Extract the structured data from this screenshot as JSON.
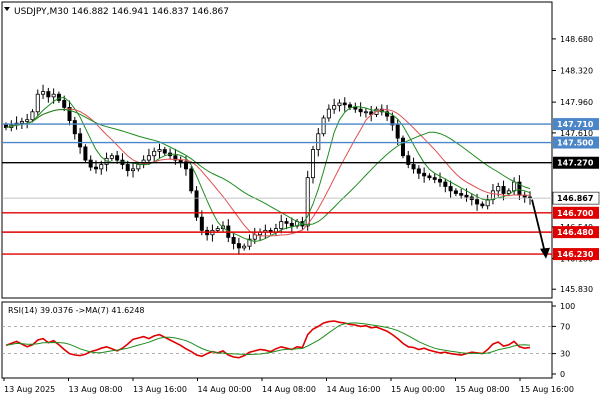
{
  "chart_data": {
    "type": "candlestick",
    "symbol_label": "USDJPY,M30",
    "ohlc_header": "146.882 146.941 146.837 146.867",
    "price_axis": {
      "ylim": [
        145.73,
        149.1
      ],
      "ticks": [
        "148.680",
        "148.320",
        "147.960",
        "147.610",
        "146.540",
        "146.180",
        "145.830"
      ]
    },
    "time_axis": {
      "labels": [
        "13 Aug 2025",
        "13 Aug 08:00",
        "13 Aug 16:00",
        "14 Aug 00:00",
        "14 Aug 08:00",
        "14 Aug 16:00",
        "15 Aug 00:00",
        "15 Aug 08:00",
        "15 Aug 16:00"
      ]
    },
    "levels": [
      {
        "value": 147.71,
        "label": "147.710",
        "color": "#4a86c8",
        "tag_color": "#4a86c8"
      },
      {
        "value": 147.5,
        "label": "147.500",
        "color": "#4a86c8",
        "tag_color": "#4a86c8"
      },
      {
        "value": 147.27,
        "label": "147.270",
        "color": "#000000",
        "tag_color": "#000000"
      },
      {
        "value": 146.7,
        "label": "146.700",
        "color": "#e00000",
        "tag_color": "#e00000"
      },
      {
        "value": 146.48,
        "label": "146.480",
        "color": "#e00000",
        "tag_color": "#e00000"
      },
      {
        "value": 146.23,
        "label": "146.230",
        "color": "#e00000",
        "tag_color": "#e00000"
      }
    ],
    "current_price": {
      "value": 146.867,
      "label": "146.867"
    },
    "close_series": [
      147.67,
      147.7,
      147.72,
      147.74,
      147.76,
      147.85,
      148.05,
      148.08,
      148.02,
      148.05,
      147.98,
      147.9,
      147.75,
      147.6,
      147.45,
      147.3,
      147.22,
      147.2,
      147.25,
      147.32,
      147.35,
      147.3,
      147.25,
      147.18,
      147.2,
      147.25,
      147.3,
      147.35,
      147.4,
      147.42,
      147.38,
      147.35,
      147.3,
      147.28,
      147.2,
      146.95,
      146.65,
      146.5,
      146.45,
      146.5,
      146.52,
      146.55,
      146.42,
      146.35,
      146.3,
      146.32,
      146.4,
      146.45,
      146.48,
      146.5,
      146.48,
      146.52,
      146.6,
      146.58,
      146.55,
      146.6,
      146.55,
      147.1,
      147.42,
      147.6,
      147.78,
      147.88,
      147.92,
      147.95,
      147.93,
      147.9,
      147.88,
      147.85,
      147.85,
      147.82,
      147.88,
      147.85,
      147.8,
      147.7,
      147.55,
      147.35,
      147.25,
      147.2,
      147.15,
      147.12,
      147.1,
      147.08,
      147.05,
      147.0,
      146.95,
      146.92,
      146.9,
      146.88,
      146.85,
      146.8,
      146.78,
      146.85,
      146.95,
      147.0,
      146.92,
      146.95,
      147.05,
      146.9,
      146.88,
      146.87
    ],
    "forecast_arrow": {
      "from": 146.85,
      "to": 146.2
    },
    "rsi_panel": {
      "label": "RSI(14) 39.0376  ->MA(7) 41.6248",
      "ylim": [
        0,
        100
      ],
      "ticks": [
        "100",
        "70",
        "30",
        "0"
      ],
      "rsi": [
        42,
        45,
        48,
        44,
        40,
        43,
        50,
        52,
        46,
        49,
        43,
        36,
        30,
        28,
        27,
        29,
        33,
        35,
        38,
        40,
        37,
        34,
        38,
        44,
        51,
        53,
        55,
        52,
        56,
        58,
        54,
        50,
        46,
        42,
        37,
        33,
        28,
        26,
        30,
        33,
        31,
        34,
        28,
        25,
        24,
        27,
        32,
        34,
        36,
        35,
        33,
        37,
        40,
        38,
        36,
        40,
        39,
        58,
        66,
        70,
        75,
        77,
        78,
        76,
        75,
        73,
        72,
        70,
        71,
        68,
        69,
        66,
        63,
        58,
        52,
        45,
        40,
        39,
        36,
        38,
        35,
        33,
        31,
        32,
        30,
        29,
        28,
        30,
        32,
        31,
        30,
        36,
        44,
        47,
        41,
        43,
        48,
        40,
        38,
        39
      ],
      "colors": {
        "rsi": "#e00000",
        "ma": "#1e8c1e"
      }
    },
    "ma_colors": {
      "fast": "#1e8c1e",
      "slow": "#e05050",
      "long": "#1e8c1e"
    }
  }
}
